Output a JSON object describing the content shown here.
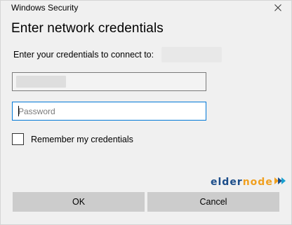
{
  "window": {
    "title": "Windows Security"
  },
  "dialog": {
    "heading": "Enter network credentials",
    "prompt": "Enter your credentials to connect to:"
  },
  "fields": {
    "username": {
      "value": ""
    },
    "password": {
      "placeholder": "Password",
      "value": ""
    }
  },
  "remember": {
    "label": "Remember my credentials",
    "checked": false
  },
  "buttons": {
    "ok": "OK",
    "cancel": "Cancel"
  },
  "watermark": {
    "part1": "elder",
    "part2": "node"
  },
  "colors": {
    "focus_border": "#0078d7",
    "button_bg": "#cccccc",
    "dialog_bg": "#f0f0f0"
  },
  "icons": {
    "close": "close-icon",
    "logo_arrows": "arrows-icon"
  }
}
